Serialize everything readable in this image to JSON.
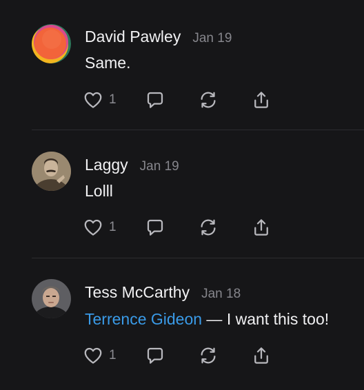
{
  "comments": [
    {
      "author": "David Pawley",
      "date": "Jan 19",
      "body": "Same.",
      "likes": "1"
    },
    {
      "author": "Laggy",
      "date": "Jan 19",
      "body": "Lolll",
      "likes": "1"
    },
    {
      "author": "Tess McCarthy",
      "date": "Jan 18",
      "mention": "Terrence Gideon",
      "body": " — I want this too!",
      "likes": "1"
    }
  ],
  "icons": {
    "like": "heart-icon",
    "reply": "speech-bubble-icon",
    "restack": "restack-icon",
    "share": "share-icon"
  },
  "colors": {
    "background": "#161618",
    "text": "#f1f1f3",
    "muted": "#86868c",
    "mention": "#3a9be8",
    "divider": "#2c2c30"
  }
}
